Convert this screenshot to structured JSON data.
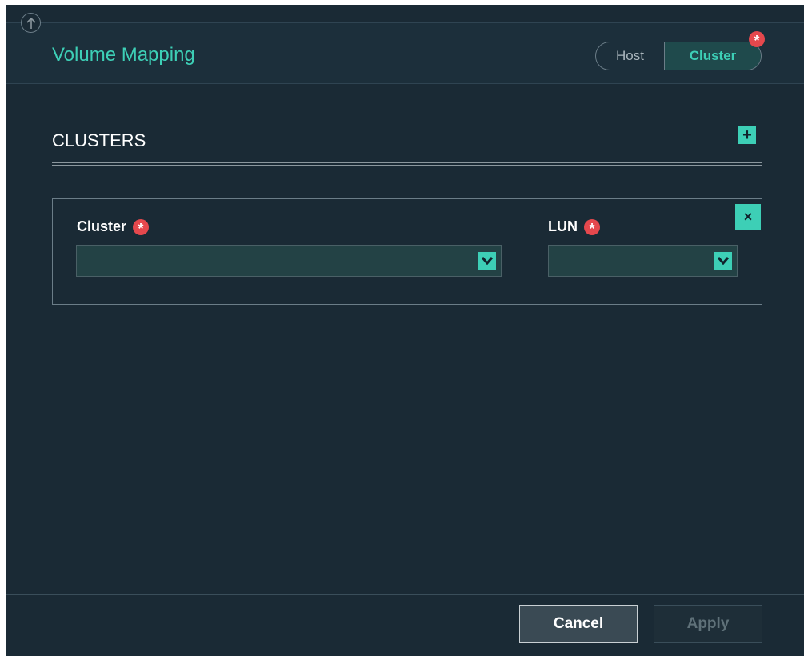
{
  "header": {
    "title": "Volume Mapping",
    "toggle": {
      "options": [
        "Host",
        "Cluster"
      ],
      "selected": "Cluster",
      "required_marker": "*"
    },
    "collapse_icon": "arrow-up-circle-icon"
  },
  "section": {
    "title": "CLUSTERS",
    "add_label": "+"
  },
  "mapping_row": {
    "close_label": "×",
    "cluster_field": {
      "label": "Cluster",
      "required_marker": "*",
      "value": ""
    },
    "lun_field": {
      "label": "LUN",
      "required_marker": "*",
      "value": ""
    }
  },
  "footer": {
    "cancel_label": "Cancel",
    "apply_label": "Apply"
  },
  "colors": {
    "background": "#1a2a35",
    "accent": "#3dcfb6",
    "required": "#e5484d"
  }
}
